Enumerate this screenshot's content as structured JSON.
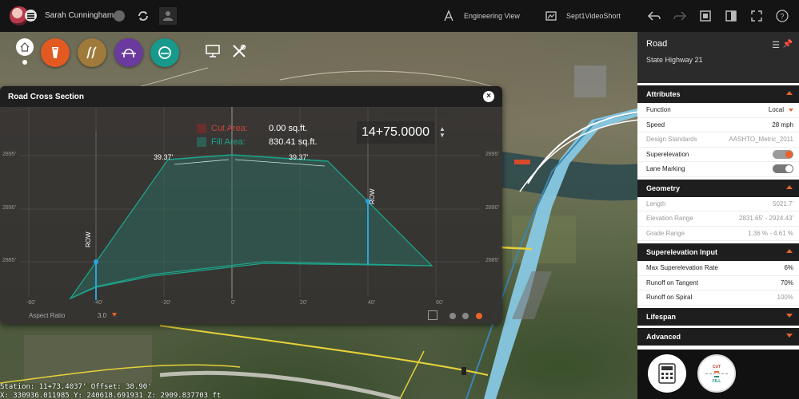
{
  "user": {
    "name": "Sarah Cunningham"
  },
  "header": {
    "view_mode": "Engineering View",
    "project": "Sept1VideoShort"
  },
  "cross_section": {
    "title": "Road Cross Section",
    "cut_label": "Cut Area:",
    "cut_value": "0.00 sq.ft.",
    "fill_label": "Fill Area:",
    "fill_value": "830.41 sq.ft.",
    "station": "14+75.0000",
    "aspect_label": "Aspect Ratio",
    "aspect_value": "3.0",
    "cut_color": "#b23a3a",
    "fill_color": "#1e8f7a",
    "row_label": "ROW",
    "dimension_left": "39.37'",
    "dimension_right": "39.37'",
    "y_ticks": [
      "2895'",
      "2890'",
      "2885'"
    ],
    "x_ticks": [
      "-60'",
      "-40'",
      "-20'",
      "0'",
      "20'",
      "40'",
      "60'"
    ]
  },
  "status": {
    "line1": "Station: 11+73.4037' Offset: 38.90'",
    "line2": "X: 330936.011985 Y: 240618.691931 Z: 2909.837703 ft"
  },
  "properties": {
    "title": "Road",
    "subtitle": "State Highway 21",
    "sections": {
      "attributes": "Attributes",
      "geometry": "Geometry",
      "superelevation_input": "Superelevation Input",
      "lifespan": "Lifespan",
      "advanced": "Advanced"
    },
    "attributes": {
      "function_label": "Function",
      "function_value": "Local",
      "speed_label": "Speed",
      "speed_value": "28 mph",
      "design_label": "Design Standards",
      "design_value": "AASHTO_Metric_2011",
      "super_label": "Superelevation",
      "lane_label": "Lane Marking"
    },
    "geometry": {
      "length_label": "Length",
      "length_value": "5021.7'",
      "elev_label": "Elevation Range",
      "elev_value": "2831.65' - 2924.43'",
      "grade_label": "Grade Range",
      "grade_value": "1.36 % - 4.61 %"
    },
    "super_input": {
      "max_label": "Max Superelevation Rate",
      "max_value": "6%",
      "tangent_label": "Runoff on Tangent",
      "tangent_value": "70%",
      "spiral_label": "Runoff on Spiral",
      "spiral_value": "100%"
    },
    "cutfill": {
      "cut": "CUT",
      "fill": "FILL"
    }
  },
  "colors": {
    "accent": "#e8632b",
    "teal": "#1e8f7a"
  }
}
